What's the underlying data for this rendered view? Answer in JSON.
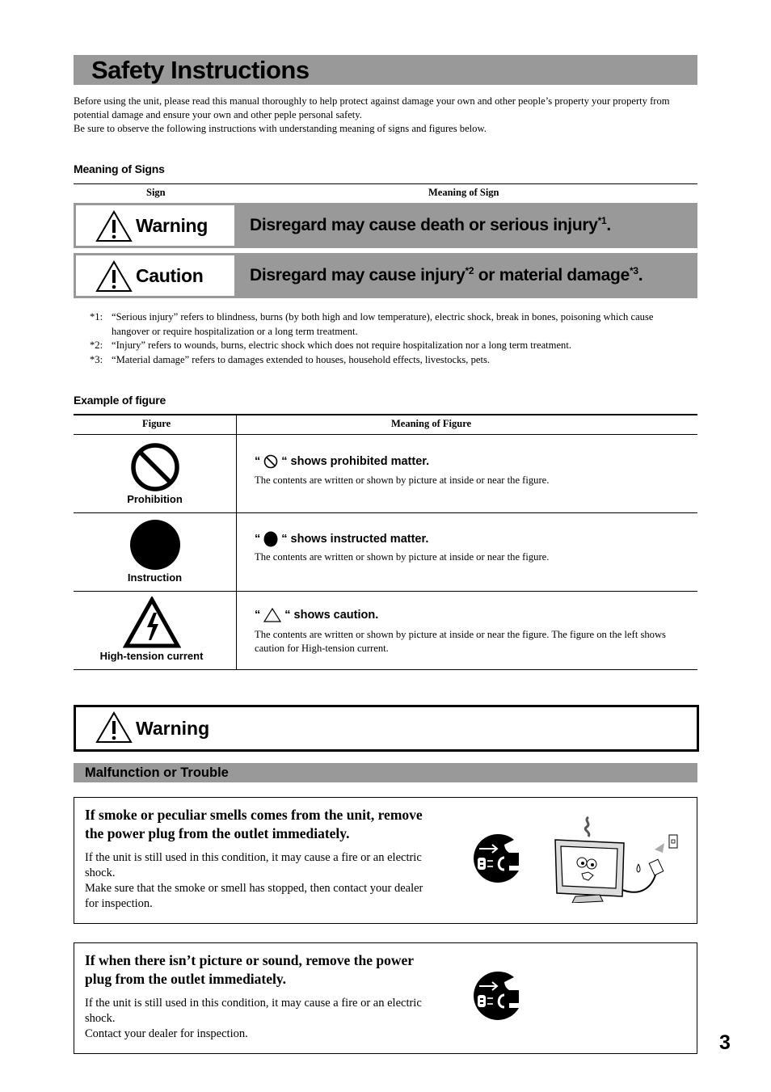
{
  "page": {
    "title": "Safety Instructions",
    "page_number": "3"
  },
  "intro": {
    "line1": "Before using the unit, please read this manual thoroughly to help protect against damage your own and other people’s property your property from potential damage and ensure your own and other peple personal safety.",
    "line2": "Be sure to observe the following instructions  with understanding meaning of signs and figures below."
  },
  "signs": {
    "section_label": "Meaning of Signs",
    "col_sign": "Sign",
    "col_meaning": "Meaning of Sign",
    "rows": [
      {
        "label": "Warning",
        "icon": "warning-triangle-icon",
        "meaning": "Disregard may cause death or serious injury",
        "ref1": "*1",
        "tail": "."
      },
      {
        "label": "Caution",
        "icon": "warning-triangle-icon",
        "meaning_a": "Disregard may cause injury",
        "ref_a": "*2",
        "meaning_b": " or material damage",
        "ref_b": "*3",
        "tail": "."
      }
    ]
  },
  "notes": [
    {
      "mark": "*1:",
      "text": "“Serious injury” refers to blindness, burns (by both high and low temperature), electric shock, break in bones, poisoning which cause hangover or require hospitalization or a long term treatment."
    },
    {
      "mark": "*2:",
      "text": "“Injury” refers to wounds, burns, electric shock which does not require hospitalization nor a long term treatment."
    },
    {
      "mark": "*3:",
      "text": "“Material damage” refers to damages extended to houses, household effects, livestocks, pets."
    }
  ],
  "figures": {
    "section_label": "Example of figure",
    "col_figure": "Figure",
    "col_meaning": "Meaning of Figure",
    "rows": [
      {
        "caption": "Prohibition",
        "icon": "prohibition-icon",
        "quote_open": "“",
        "quote_close": "“ shows prohibited matter.",
        "desc": "The contents are written or shown by picture at inside or near the figure."
      },
      {
        "caption": "Instruction",
        "icon": "instruction-dot-icon",
        "quote_open": "“",
        "quote_close": "“ shows instructed matter.",
        "desc": "The contents are written or shown by picture at inside or near the figure."
      },
      {
        "caption": "High-tension current",
        "icon": "high-voltage-icon",
        "quote_open": "“",
        "quote_close": "“ shows caution.",
        "desc": "The contents are written or shown by picture at inside or near the figure.  The figure on the left shows caution for High-tension current."
      }
    ]
  },
  "warning_banner": {
    "label": "Warning"
  },
  "malfunction": {
    "section_label": "Malfunction or Trouble",
    "items": [
      {
        "headline": "If smoke or peculiar smells comes from the unit, remove the power plug from the outlet immediately.",
        "body1": "If the unit is still used in this condition, it may cause a fire or an electric shock.",
        "body2": "Make sure that the smoke or smell has stopped, then contact your dealer for inspection.",
        "icons": [
          "unplug-icon",
          "smoking-tv-illustration"
        ]
      },
      {
        "headline": "If when there isn’t picture or sound, remove the power plug from the outlet immediately.",
        "body1": "If the unit is still used in this condition, it may cause a fire or an electric shock.",
        "body2": "Contact your dealer for inspection.",
        "icons": [
          "unplug-icon"
        ]
      }
    ]
  },
  "colors": {
    "gray_bar": "#999999",
    "text": "#000000",
    "background": "#ffffff"
  }
}
